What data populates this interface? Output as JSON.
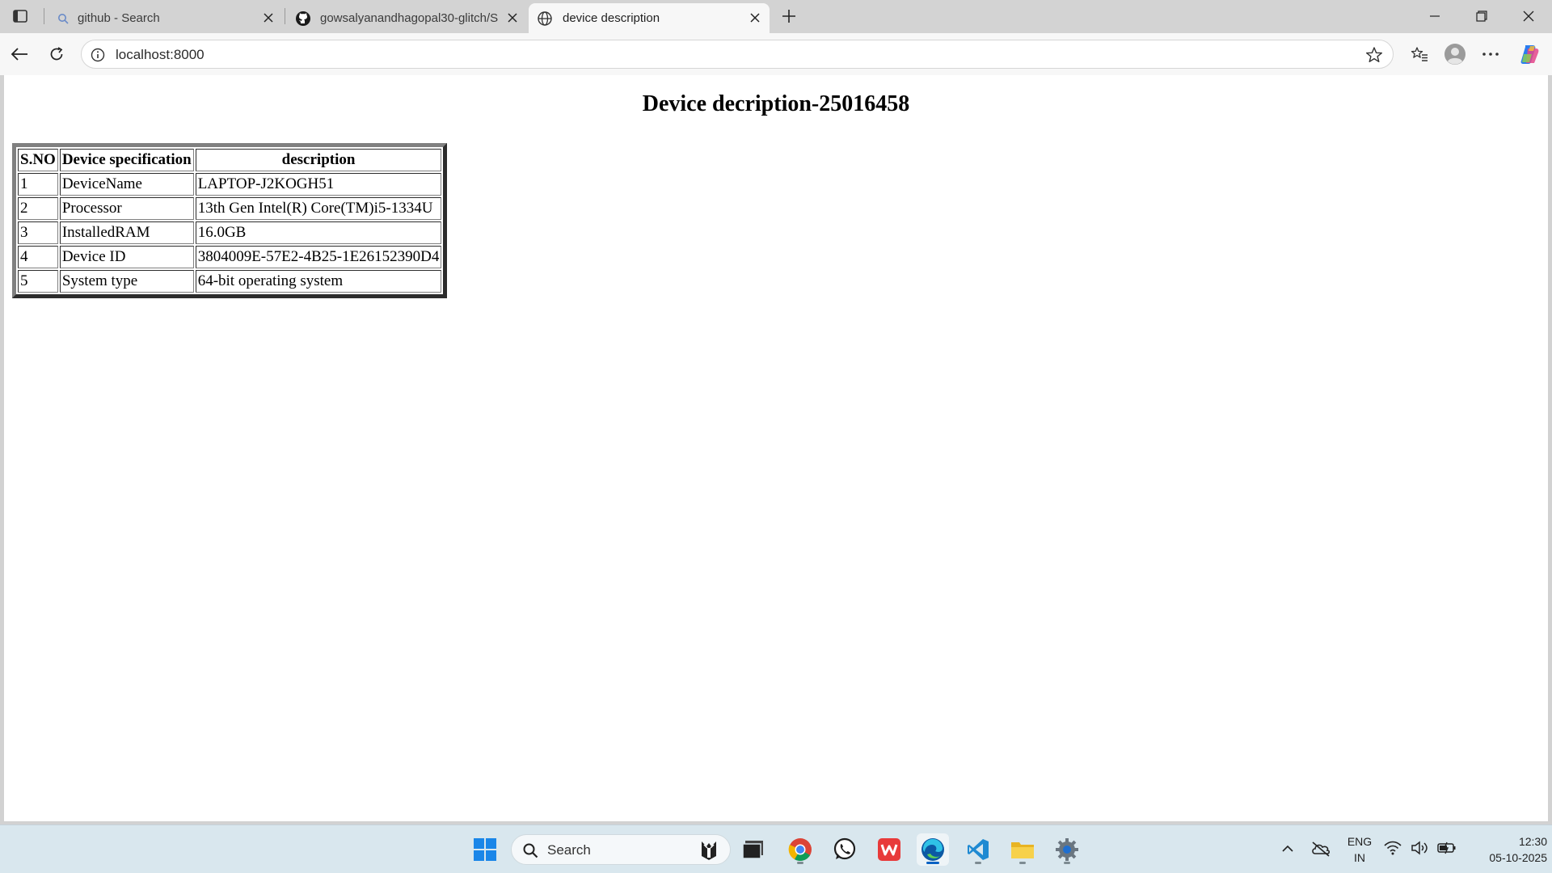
{
  "browser": {
    "tabs": [
      {
        "title": "github - Search",
        "active": false
      },
      {
        "title": "gowsalyanandhagopal30-glitch/S",
        "active": false
      },
      {
        "title": "device description",
        "active": true
      }
    ],
    "address": "localhost:8000"
  },
  "page": {
    "heading": "Device decription-25016458",
    "table": {
      "headers": [
        "S.NO",
        "Device specification",
        "description"
      ],
      "rows": [
        [
          "1",
          "DeviceName",
          "LAPTOP-J2KOGH51"
        ],
        [
          "2",
          "Processor",
          "13th Gen Intel(R) Core(TM)i5-1334U"
        ],
        [
          "3",
          "InstalledRAM",
          "16.0GB"
        ],
        [
          "4",
          "Device ID",
          "3804009E-57E2-4B25-1E26152390D4"
        ],
        [
          "5",
          "System type",
          "64-bit operating system"
        ]
      ]
    }
  },
  "taskbar": {
    "search_placeholder": "Search",
    "lang_line1": "ENG",
    "lang_line2": "IN",
    "time": "12:30",
    "date": "05-10-2025",
    "apps": [
      "start-icon",
      "task-view-icon",
      "chrome-icon",
      "whatsapp-icon",
      "wps-office-icon",
      "edge-icon",
      "vscode-icon",
      "file-explorer-icon",
      "settings-icon"
    ]
  },
  "colors": {
    "accent": "#0a62c4",
    "taskbar_bg": "#d9e7ee",
    "tabstrip_bg": "#d3d3d3"
  }
}
